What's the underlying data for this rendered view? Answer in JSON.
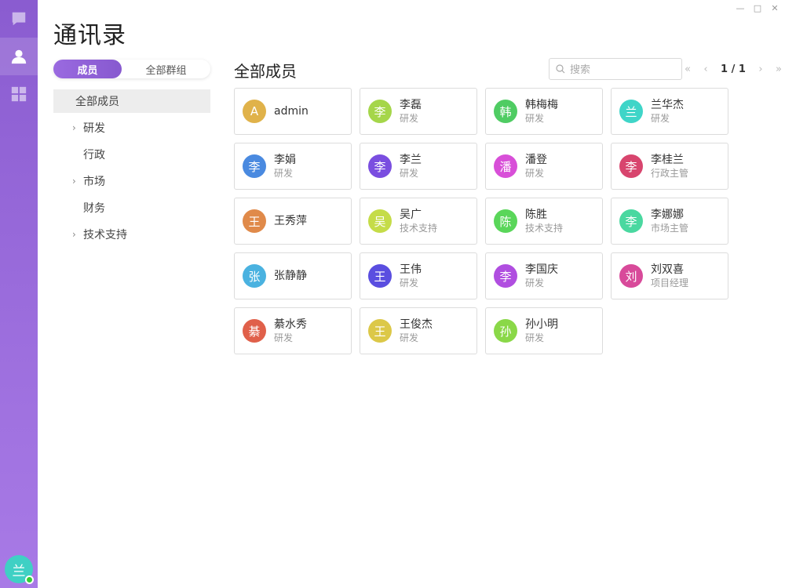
{
  "window": {
    "minimize": "—",
    "maximize": "□",
    "close": "✕"
  },
  "nav": {
    "items": [
      {
        "name": "chat",
        "icon": "chat-bubble-icon"
      },
      {
        "name": "contacts",
        "icon": "user-icon",
        "active": true
      },
      {
        "name": "apps",
        "icon": "grid-icon"
      }
    ],
    "user_avatar": {
      "char": "兰",
      "color": "#3fd0c4",
      "online": true
    }
  },
  "page_title": "通讯录",
  "tabs": {
    "members": "成员",
    "groups": "全部群组"
  },
  "tree": {
    "all": "全部成员",
    "items": [
      {
        "label": "研发",
        "expandable": true
      },
      {
        "label": "行政",
        "expandable": false
      },
      {
        "label": "市场",
        "expandable": true
      },
      {
        "label": "财务",
        "expandable": false
      },
      {
        "label": "技术支持",
        "expandable": true
      }
    ]
  },
  "main": {
    "title": "全部成员",
    "search_placeholder": "搜索",
    "pager": {
      "text": "1 / 1"
    }
  },
  "members": [
    {
      "char": "A",
      "name": "admin",
      "dept": "",
      "color": "#e0b24a"
    },
    {
      "char": "李",
      "name": "李磊",
      "dept": "研发",
      "color": "#a5d64a"
    },
    {
      "char": "韩",
      "name": "韩梅梅",
      "dept": "研发",
      "color": "#4fcc63"
    },
    {
      "char": "兰",
      "name": "兰华杰",
      "dept": "研发",
      "color": "#3fd5c8"
    },
    {
      "char": "李",
      "name": "李娟",
      "dept": "研发",
      "color": "#4a8ae0"
    },
    {
      "char": "李",
      "name": "李兰",
      "dept": "研发",
      "color": "#7a4ee0"
    },
    {
      "char": "潘",
      "name": "潘登",
      "dept": "研发",
      "color": "#d84fd8"
    },
    {
      "char": "李",
      "name": "李桂兰",
      "dept": "行政主管",
      "color": "#d8456e"
    },
    {
      "char": "王",
      "name": "王秀萍",
      "dept": "",
      "color": "#e08a4a"
    },
    {
      "char": "吴",
      "name": "吴广",
      "dept": "技术支持",
      "color": "#c5dc48"
    },
    {
      "char": "陈",
      "name": "陈胜",
      "dept": "技术支持",
      "color": "#5ad65a"
    },
    {
      "char": "李",
      "name": "李娜娜",
      "dept": "市场主管",
      "color": "#4ad8a0"
    },
    {
      "char": "张",
      "name": "张静静",
      "dept": "",
      "color": "#4ab2e0"
    },
    {
      "char": "王",
      "name": "王伟",
      "dept": "研发",
      "color": "#5a4ee0"
    },
    {
      "char": "李",
      "name": "李国庆",
      "dept": "研发",
      "color": "#b04ee0"
    },
    {
      "char": "刘",
      "name": "刘双喜",
      "dept": "项目经理",
      "color": "#d84a9a"
    },
    {
      "char": "綦",
      "name": "綦水秀",
      "dept": "研发",
      "color": "#e0604a"
    },
    {
      "char": "王",
      "name": "王俊杰",
      "dept": "研发",
      "color": "#dcc848"
    },
    {
      "char": "孙",
      "name": "孙小明",
      "dept": "研发",
      "color": "#8ad848"
    }
  ]
}
